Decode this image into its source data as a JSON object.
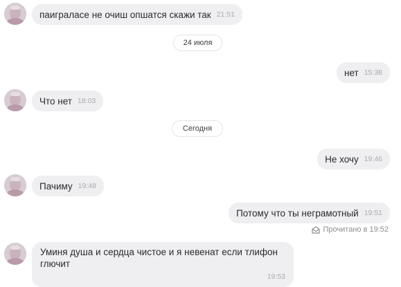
{
  "messages": [
    {
      "text": "паиграласе не очиш опшатся скажи так",
      "time": "21:51"
    },
    {
      "text": "нет",
      "time": "15:38"
    },
    {
      "text": "Что нет",
      "time": "18:03"
    },
    {
      "text": "Не хочу",
      "time": "19:46"
    },
    {
      "text": "Пачиму",
      "time": "19:48"
    },
    {
      "text": "Потому что ты неграмотный",
      "time": "19:51"
    },
    {
      "text": "Уминя душа и сердца чистое и я невенат если тлифон глючит",
      "time": "19:53"
    }
  ],
  "dates": [
    "24 июля",
    "Сегодня"
  ],
  "read_status": {
    "text": "Прочитано в 19:52",
    "icon": "envelope-open-icon"
  },
  "colors": {
    "bubble": "#efeff2",
    "time": "#a9a9ae",
    "avatar_bg": "#d9cdd6"
  }
}
